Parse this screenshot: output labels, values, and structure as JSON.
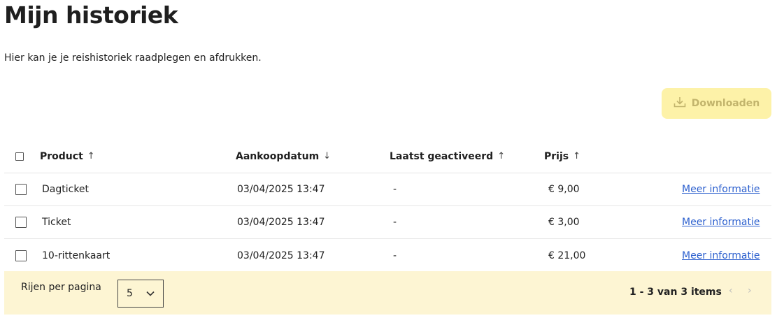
{
  "page": {
    "title": "Mijn historiek",
    "intro": "Hier kan je je reishistoriek raadplegen en afdrukken."
  },
  "toolbar": {
    "download_label": "Downloaden",
    "download_icon": "download-icon"
  },
  "table": {
    "columns": [
      {
        "label": "Product",
        "sort": "↑"
      },
      {
        "label": "Aankoopdatum",
        "sort": "↓"
      },
      {
        "label": "Laatst geactiveerd",
        "sort": "↑"
      },
      {
        "label": "Prijs",
        "sort": "↑"
      }
    ],
    "rows": [
      {
        "product": "Dagticket",
        "aankoopdatum": "03/04/2025 13:47",
        "geactiveerd": "-",
        "prijs": "€ 9,00",
        "link": "Meer informatie"
      },
      {
        "product": "Ticket",
        "aankoopdatum": "03/04/2025 13:47",
        "geactiveerd": "-",
        "prijs": "€ 3,00",
        "link": "Meer informatie"
      },
      {
        "product": "10-rittenkaart",
        "aankoopdatum": "03/04/2025 13:47",
        "geactiveerd": "-",
        "prijs": "€ 21,00",
        "link": "Meer informatie"
      }
    ]
  },
  "pagination": {
    "rows_label": "Rijen per pagina",
    "rows_value": "5",
    "range": "1 - 3 van 3 items",
    "prev": "‹",
    "next": "›"
  },
  "colors": {
    "accent_disabled": "#fdf2a8",
    "footer_bg": "#fdf5d3",
    "link": "#2b5fce"
  }
}
